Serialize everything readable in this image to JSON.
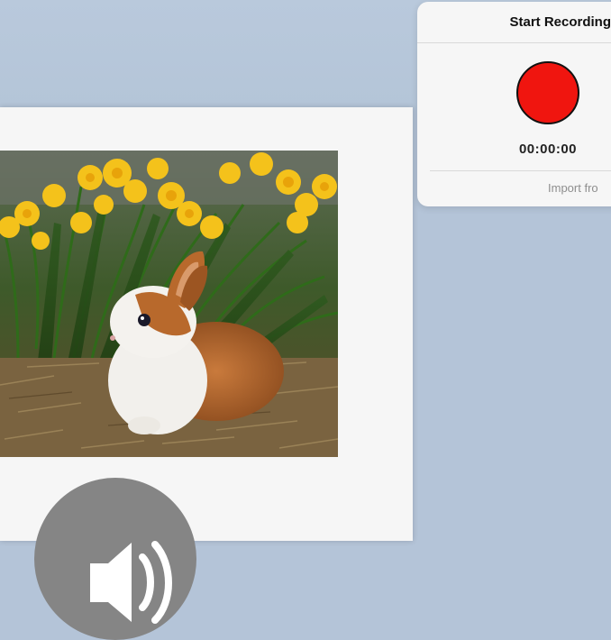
{
  "popover": {
    "title": "Start Recording",
    "timer": "00:00:00",
    "import_label": "Import fro",
    "record_color": "#f0150f"
  },
  "page": {
    "image_alt": "rabbit-among-daffodils-photo",
    "speaker_icon": "speaker-icon"
  },
  "colors": {
    "background": "#b4c4d8",
    "page": "#f6f6f6",
    "speaker_button": "#858585"
  }
}
